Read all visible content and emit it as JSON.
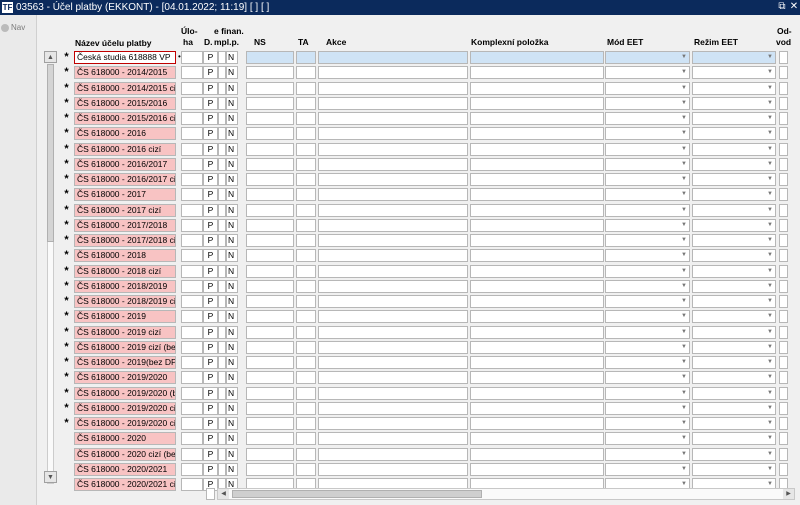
{
  "window": {
    "title": "03563 - Účel platby (EKKONT) - [04.01.2022; 11:19]  [ ]  [ ]",
    "app_icon_text": "TF",
    "restore_symbol": "⧉",
    "close_symbol": "✕"
  },
  "nav": {
    "label": "Nav"
  },
  "columns": {
    "nazev": "Název účelu platby",
    "uloha_1": "Úlo-",
    "uloha_2": "ha",
    "d": "D.",
    "finan_1": "e finan.",
    "finan_2": "mpl.p.",
    "ns": "NS",
    "ta": "TA",
    "akce": "Akce",
    "komplexni": "Komplexní položka",
    "mod_eet": "Mód EET",
    "rezim_eet": "Režim EET",
    "odvod_1": "Od-",
    "odvod_2": "vod"
  },
  "scroll": {
    "up": "▲",
    "down": "▼",
    "left": "◀",
    "right": "▶"
  },
  "rows": [
    {
      "marker": "*",
      "name": "Česká studia 618888 VP",
      "d": "P",
      "mpl": "N",
      "selected": true
    },
    {
      "marker": "*",
      "name": "ČS 618000 - 2014/2015",
      "d": "P",
      "mpl": "N"
    },
    {
      "marker": "*",
      "name": "ČS 618000 - 2014/2015 ciz",
      "d": "P",
      "mpl": "N"
    },
    {
      "marker": "*",
      "name": "ČS 618000 - 2015/2016",
      "d": "P",
      "mpl": "N"
    },
    {
      "marker": "*",
      "name": "ČS 618000 - 2015/2016 ciz",
      "d": "P",
      "mpl": "N"
    },
    {
      "marker": "*",
      "name": "ČS 618000 - 2016",
      "d": "P",
      "mpl": "N"
    },
    {
      "marker": "*",
      "name": "ČS 618000 - 2016 cizí",
      "d": "P",
      "mpl": "N"
    },
    {
      "marker": "*",
      "name": "ČS 618000 - 2016/2017",
      "d": "P",
      "mpl": "N"
    },
    {
      "marker": "*",
      "name": "ČS 618000 - 2016/2017 ciz",
      "d": "P",
      "mpl": "N"
    },
    {
      "marker": "*",
      "name": "ČS 618000 - 2017",
      "d": "P",
      "mpl": "N"
    },
    {
      "marker": "*",
      "name": "ČS 618000 - 2017 cizí",
      "d": "P",
      "mpl": "N"
    },
    {
      "marker": "*",
      "name": "ČS 618000 - 2017/2018",
      "d": "P",
      "mpl": "N"
    },
    {
      "marker": "*",
      "name": "ČS 618000 - 2017/2018 ciz",
      "d": "P",
      "mpl": "N"
    },
    {
      "marker": "*",
      "name": "ČS 618000 - 2018",
      "d": "P",
      "mpl": "N"
    },
    {
      "marker": "*",
      "name": "ČS 618000 - 2018 cizí",
      "d": "P",
      "mpl": "N"
    },
    {
      "marker": "*",
      "name": "ČS 618000 - 2018/2019",
      "d": "P",
      "mpl": "N"
    },
    {
      "marker": "*",
      "name": "ČS 618000 - 2018/2019 ciz",
      "d": "P",
      "mpl": "N"
    },
    {
      "marker": "*",
      "name": "ČS 618000 - 2019",
      "d": "P",
      "mpl": "N"
    },
    {
      "marker": "*",
      "name": "ČS 618000 - 2019 cizí",
      "d": "P",
      "mpl": "N"
    },
    {
      "marker": "*",
      "name": "ČS 618000 - 2019 cizí (bez",
      "d": "P",
      "mpl": "N"
    },
    {
      "marker": "*",
      "name": "ČS 618000 - 2019(bez DPH",
      "d": "P",
      "mpl": "N"
    },
    {
      "marker": "*",
      "name": "ČS 618000 - 2019/2020",
      "d": "P",
      "mpl": "N"
    },
    {
      "marker": "*",
      "name": "ČS 618000 - 2019/2020 (be",
      "d": "P",
      "mpl": "N"
    },
    {
      "marker": "*",
      "name": "ČS 618000 - 2019/2020 ciz",
      "d": "P",
      "mpl": "N"
    },
    {
      "marker": "*",
      "name": "ČS 618000 - 2019/2020 ciz",
      "d": "P",
      "mpl": "N"
    },
    {
      "marker": "",
      "name": "ČS 618000 - 2020",
      "d": "P",
      "mpl": "N"
    },
    {
      "marker": "",
      "name": "ČS 618000 - 2020 cizí (bez",
      "d": "P",
      "mpl": "N"
    },
    {
      "marker": "",
      "name": "ČS 618000 - 2020/2021",
      "d": "P",
      "mpl": "N"
    },
    {
      "marker": "",
      "name": "ČS 618000 - 2020/2021 ciz",
      "d": "P",
      "mpl": "N"
    }
  ],
  "colors": {
    "titlebar": "#0b2a5c",
    "name_cell": "#f8c3c3",
    "selected_row": "#cfe3f5"
  }
}
